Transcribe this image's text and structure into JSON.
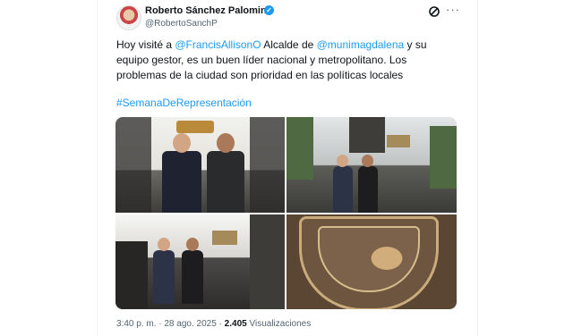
{
  "author": {
    "name": "Roberto Sánchez Palomino",
    "handle": "@RobertoSanchP",
    "verified_icon": "verified-badge-icon",
    "verified_color": "#1d9bf0"
  },
  "tweet": {
    "text_intro": "Hoy visité a ",
    "mention_1": "@FrancisAllisonO",
    "text_middle": " Alcalde de ",
    "mention_2": "@munimagdalena",
    "text_rest": " y su equipo gestor, es un buen líder nacional y metropolitano. Los problemas de la ciudad son prioridad en las políticas locales",
    "hashtag": "#SemanaDeRepresentación",
    "link_color": "#1d9bf0"
  },
  "meta": {
    "time": "3:40 p. m.",
    "separator": "·",
    "date": "28 ago. 2025",
    "views_count": "2.405",
    "views_label": "Visualizaciones"
  },
  "icons": {
    "grok": "grok-icon",
    "more": "more-options-icon"
  },
  "media": {
    "count": 4,
    "seal_text": "INTA  TERNA"
  }
}
